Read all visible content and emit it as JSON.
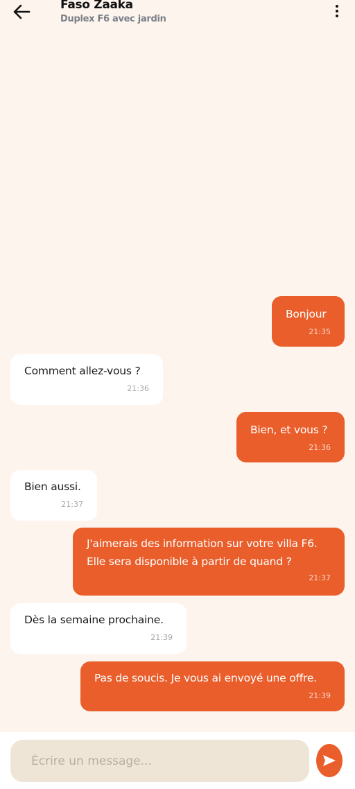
{
  "header": {
    "title": "Faso Zaaka",
    "subtitle": "Duplex F6 avec jardin"
  },
  "icons": {
    "back": "arrow-left-icon",
    "menu": "more-vertical-icon",
    "send": "send-icon"
  },
  "colors": {
    "background": "#fdf4ee",
    "accent": "#e95e2b",
    "received_bubble": "#ffffff",
    "input_bg": "#efe5d6"
  },
  "messages": [
    {
      "direction": "sent",
      "text": "Bonjour",
      "time": "21:35"
    },
    {
      "direction": "received",
      "text": "Comment allez-vous ?",
      "time": "21:36"
    },
    {
      "direction": "sent",
      "text": "Bien, et vous ?",
      "time": "21:36"
    },
    {
      "direction": "received",
      "text": "Bien aussi.",
      "time": "21:37"
    },
    {
      "direction": "sent",
      "text": "J'aimerais des information sur votre villa F6. Elle sera disponible à partir de quand ?",
      "time": "21:37"
    },
    {
      "direction": "received",
      "text": "Dès la semaine prochaine.",
      "time": "21:39"
    },
    {
      "direction": "sent",
      "text": "Pas de soucis. Je vous ai envoyé une offre.",
      "time": "21:39"
    }
  ],
  "composer": {
    "placeholder": "Écrire un message..."
  }
}
